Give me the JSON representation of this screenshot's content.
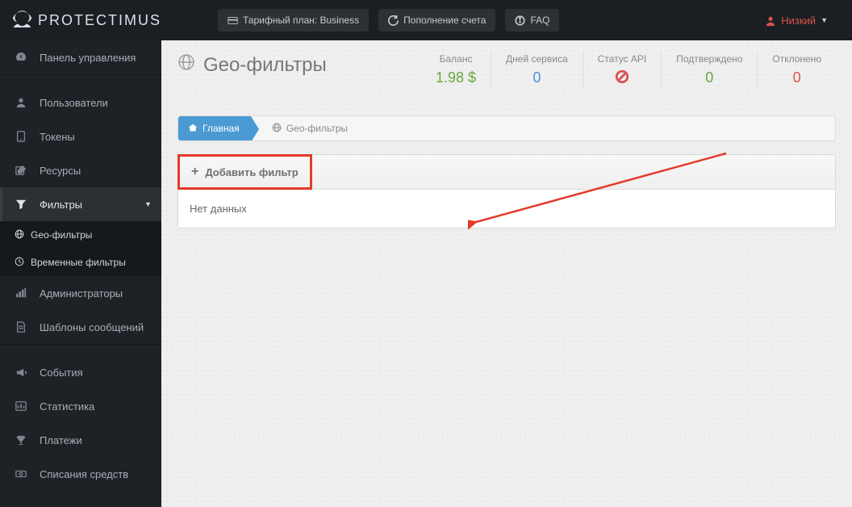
{
  "brand": "protectimus",
  "topbar": {
    "plan_label": "Тарифный план: Business",
    "topup_label": "Пополнение счета",
    "faq_label": "FAQ",
    "user_level": "Низкий"
  },
  "sidebar": {
    "dashboard": "Панель управления",
    "users": "Пользователи",
    "tokens": "Токены",
    "resources": "Ресурсы",
    "filters": "Фильтры",
    "sub_geo": "Geo-фильтры",
    "sub_time": "Временные фильтры",
    "admins": "Администраторы",
    "templates": "Шаблоны сообщений",
    "events": "События",
    "statistics": "Статистика",
    "payments": "Платежи",
    "writeoffs": "Списания средств"
  },
  "page": {
    "title": "Geo-фильтры"
  },
  "stats": {
    "balance_label": "Баланс",
    "balance_value": "1.98 $",
    "days_label": "Дней сервиса",
    "days_value": "0",
    "api_label": "Статус API",
    "approved_label": "Подтверждено",
    "approved_value": "0",
    "declined_label": "Отклонено",
    "declined_value": "0"
  },
  "breadcrumb": {
    "home": "Главная",
    "current": "Geo-фильтры"
  },
  "panel": {
    "add_filter": "Добавить фильтр",
    "empty": "Нет данных"
  }
}
